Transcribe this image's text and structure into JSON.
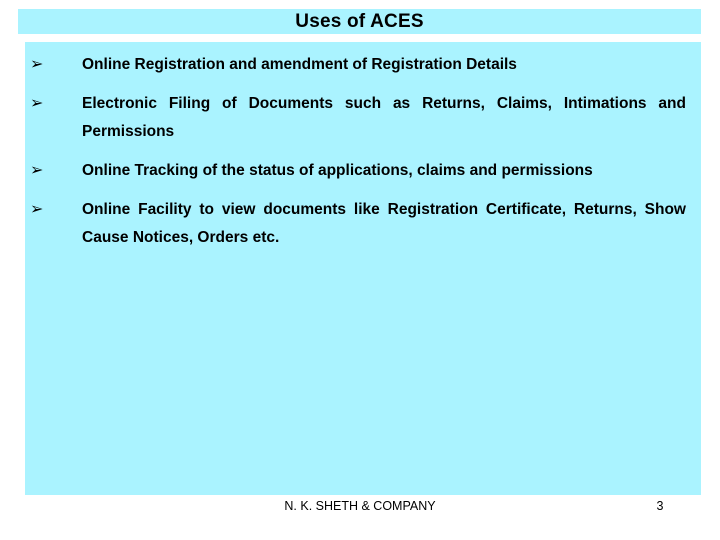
{
  "slide": {
    "title": "Uses of ACES",
    "bullet_marker_glyph": "➢",
    "bullet_marker_name": "arrowhead-bullet",
    "colors": {
      "panel_background": "#aaf3ff",
      "slide_background": "#ffffff",
      "text": "#000000"
    },
    "bullets": [
      {
        "marker": "➢",
        "text": "Online Registration and amendment of Registration Details",
        "justify": false
      },
      {
        "marker": "➢",
        "text": "Electronic Filing of Documents such as Returns, Claims, Intimations and Permissions",
        "justify": true
      },
      {
        "marker": "➢",
        "text": "Online Tracking of the status of applications, claims and permissions",
        "justify": true
      },
      {
        "marker": "➢",
        "text": "Online Facility to view documents like Registration Certificate, Returns, Show Cause Notices, Orders etc.",
        "justify": true
      }
    ],
    "footer": {
      "company": "N. K. SHETH & COMPANY",
      "page_number": "3"
    }
  }
}
